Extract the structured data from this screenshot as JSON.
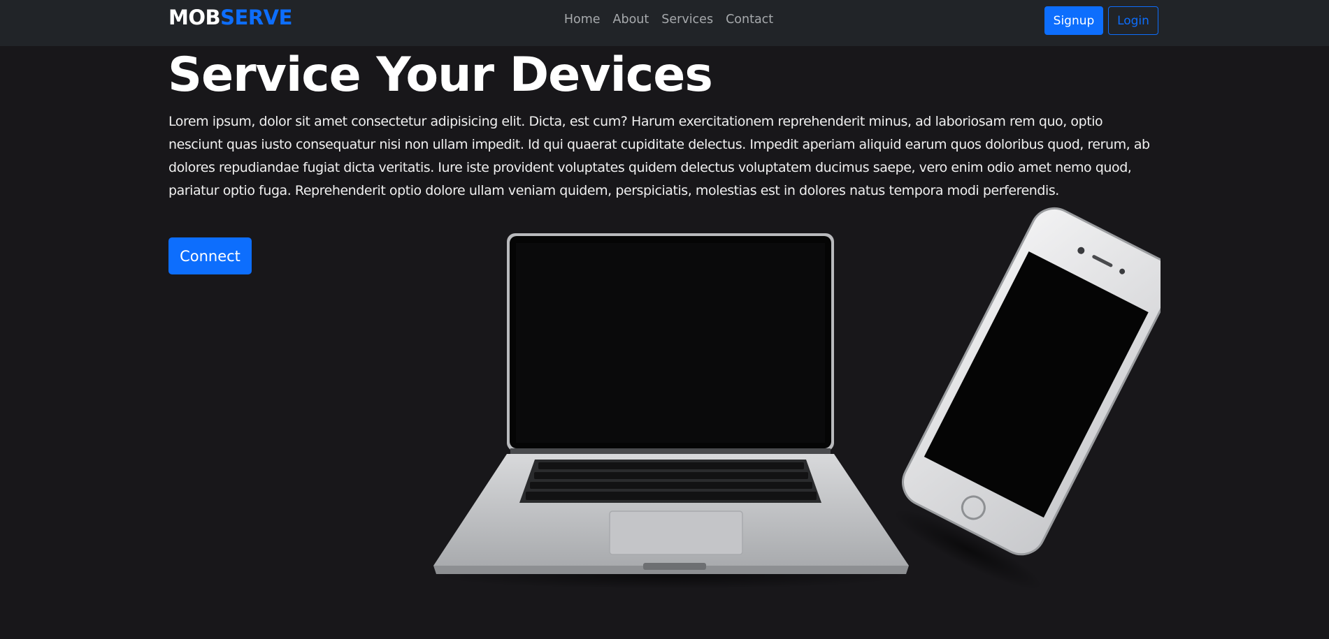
{
  "navbar": {
    "brand_part1": "MOB",
    "brand_part2": "SERVE",
    "links": [
      {
        "label": "Home"
      },
      {
        "label": "About"
      },
      {
        "label": "Services"
      },
      {
        "label": "Contact"
      }
    ],
    "signup_label": "Signup",
    "login_label": "Login"
  },
  "hero": {
    "title": "Service Your Devices",
    "text": "Lorem ipsum, dolor sit amet consectetur adipisicing elit. Dicta, est cum? Harum exercitationem reprehenderit minus, ad laboriosam rem quo, optio nesciunt quas iusto consequatur nisi non ullam impedit. Id qui quaerat cupiditate delectus. Impedit aperiam aliquid earum quos doloribus quod, rerum, ab dolores repudiandae fugiat dicta veritatis. Iure iste provident voluptates quidem delectus voluptatem ducimus saepe, vero enim odio amet nemo quod, pariatur optio fuga. Reprehenderit optio dolore ullam veniam quidem, perspiciatis, molestias est in dolores natus tempora modi perferendis.",
    "connect_label": "Connect"
  },
  "colors": {
    "accent": "#0d6efd",
    "navbar_bg": "#212428",
    "page_bg": "#18171a"
  },
  "images": {
    "hero_image": "laptop-and-phone-image"
  }
}
